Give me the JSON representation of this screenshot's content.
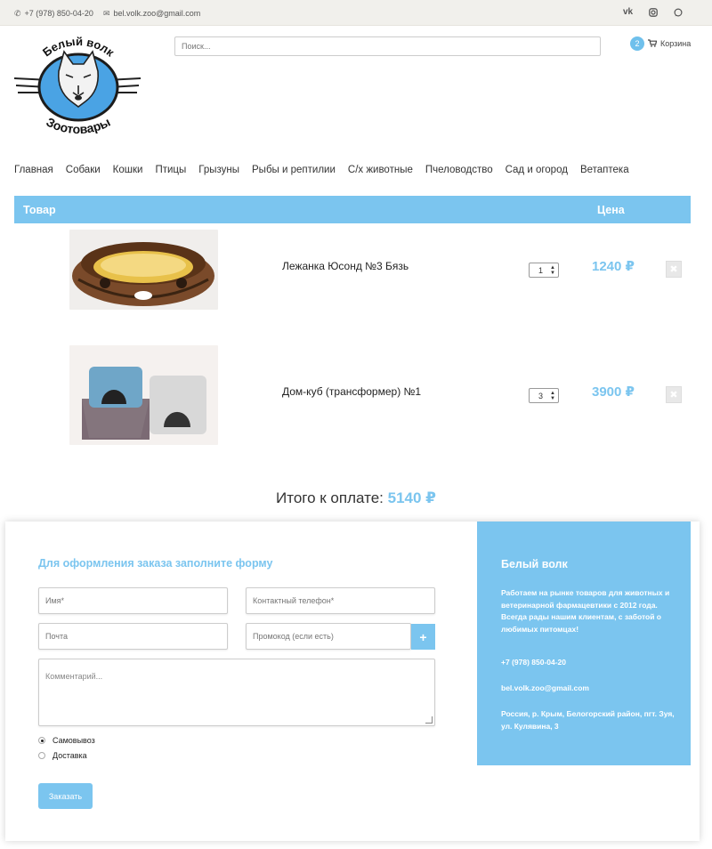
{
  "topbar": {
    "phone": "+7 (978) 850-04-20",
    "email": "bel.volk.zoo@gmail.com",
    "social": [
      "vk-icon",
      "instagram-icon",
      "whatsapp-icon"
    ]
  },
  "logo": {
    "top_text": "Белый волк",
    "bottom_text": "Зоотовары"
  },
  "search": {
    "placeholder": "Поиск..."
  },
  "cart": {
    "count": "2",
    "label": "Корзина"
  },
  "nav": [
    "Главная",
    "Собаки",
    "Кошки",
    "Птицы",
    "Грызуны",
    "Рыбы и рептилии",
    "С/х животные",
    "Пчеловодство",
    "Сад и огород",
    "Ветаптека"
  ],
  "table": {
    "col_product": "Товар",
    "col_price": "Цена"
  },
  "items": [
    {
      "name": "Лежанка Юсонд №3 Бязь",
      "qty": "1",
      "price": "1240 ₽"
    },
    {
      "name": "Дом-куб (трансформер) №1",
      "qty": "3",
      "price": "3900 ₽"
    }
  ],
  "total": {
    "label": "Итого к оплате:",
    "value": "5140 ₽"
  },
  "form": {
    "title": "Для оформления заказа заполните форму",
    "name_ph": "Имя*",
    "phone_ph": "Контактный телефон*",
    "email_ph": "Почта",
    "promo_ph": "Промокод (если есть)",
    "comment_ph": "Комментарий...",
    "pickup": "Самовывоз",
    "delivery": "Доставка",
    "submit": "Заказать"
  },
  "sidebar": {
    "title": "Белый волк",
    "about": "Работаем на рынке товаров для животных и ветеринарной фармацевтики с 2012 года. Всегда рады нашим клиентам, с заботой о любимых питомцах!",
    "phone": "+7 (978) 850-04-20",
    "email": "bel.volk.zoo@gmail.com",
    "address": "Россия, р. Крым, Белогорский район, пгт. Зуя, ул. Кулявина, 3"
  },
  "colors": {
    "accent": "#7bc5ef",
    "topbar": "#f1f0ec"
  }
}
